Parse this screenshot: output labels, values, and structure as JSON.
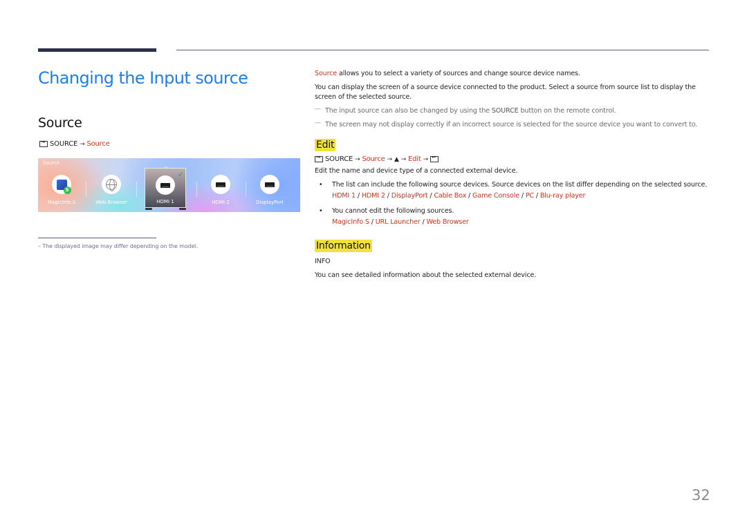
{
  "page_title": "Changing the Input source",
  "section_title": "Source",
  "left_path": {
    "icon": "source-icon",
    "items": [
      "SOURCE",
      "Source"
    ]
  },
  "source_bar": {
    "label": "Source",
    "tiles": [
      {
        "label": "MagicInfo S",
        "icon": "magicinfo-icon",
        "selected": false
      },
      {
        "label": "Web Browser",
        "icon": "globe-icon",
        "selected": false
      },
      {
        "label": "HDMI 1",
        "icon": "hdmi-port-icon",
        "selected": true
      },
      {
        "label": "HDMI 2",
        "icon": "hdmi-port-icon",
        "selected": false
      },
      {
        "label": "DisplayPort",
        "icon": "displayport-icon",
        "selected": false
      }
    ]
  },
  "footnote": "–  The displayed image may differ depending on the model.",
  "intro": {
    "keyword": "Source",
    "line1_rest": " allows you to select a variety of sources and change source device names.",
    "line2": "You can display the screen of a source device connected to the product. Select a source from source list to display the screen of the selected source.",
    "note1_pre": "The input source can also be changed by using the ",
    "note1_kw": "SOURCE",
    "note1_post": " button on the remote control.",
    "note2": "The screen may not display correctly if an incorrect source is selected for the source device you want to convert to."
  },
  "edit": {
    "heading": "Edit",
    "path": [
      "SOURCE",
      "Source",
      "▲",
      "Edit"
    ],
    "description": "Edit the name and device type of a connected external device.",
    "bullet1": "The list can include the following source devices. Source devices on the list differ depending on the selected source.",
    "bullet1_items": [
      "HDMI 1",
      "HDMI 2",
      "DisplayPort",
      "Cable Box",
      "Game Console",
      "PC",
      "Blu-ray player"
    ],
    "bullet2": "You cannot edit the following sources.",
    "bullet2_items": [
      "MagicInfo S",
      "URL Launcher",
      "Web Browser"
    ],
    "separator": " / "
  },
  "information": {
    "heading": "Information",
    "key_label": "INFO",
    "description": "You can see detailed information about the selected external device."
  },
  "page_number": "32"
}
